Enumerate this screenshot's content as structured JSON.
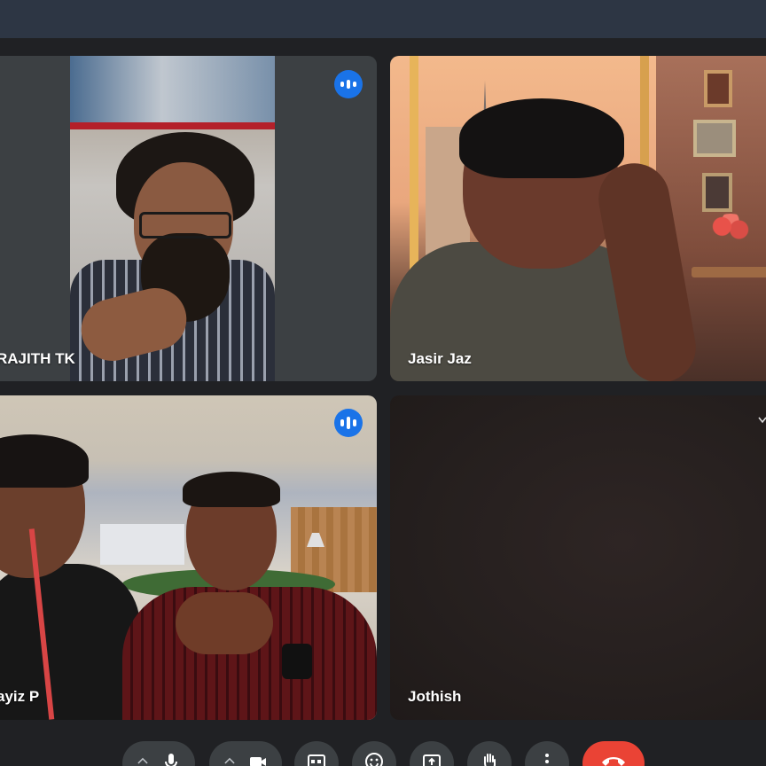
{
  "participants": [
    {
      "name": "RAJITH TK",
      "speaking": true
    },
    {
      "name": "Jasir Jaz",
      "speaking": false
    },
    {
      "name": "ayiz P",
      "speaking": true
    },
    {
      "name": "Jothish",
      "speaking": false
    }
  ],
  "controls": [
    {
      "icon": "chevron-up-icon"
    },
    {
      "icon": "microphone-icon"
    },
    {
      "icon": "chevron-up-icon"
    },
    {
      "icon": "camera-icon"
    },
    {
      "icon": "closed-captions-icon"
    },
    {
      "icon": "emoji-icon"
    },
    {
      "icon": "present-screen-icon"
    },
    {
      "icon": "raise-hand-icon"
    },
    {
      "icon": "more-options-icon"
    },
    {
      "icon": "end-call-icon"
    }
  ],
  "colors": {
    "background": "#202124",
    "tile": "#3c4043",
    "speaking_indicator": "#1a73e8",
    "end_call": "#ea4335",
    "top_bar": "#2d3644"
  }
}
